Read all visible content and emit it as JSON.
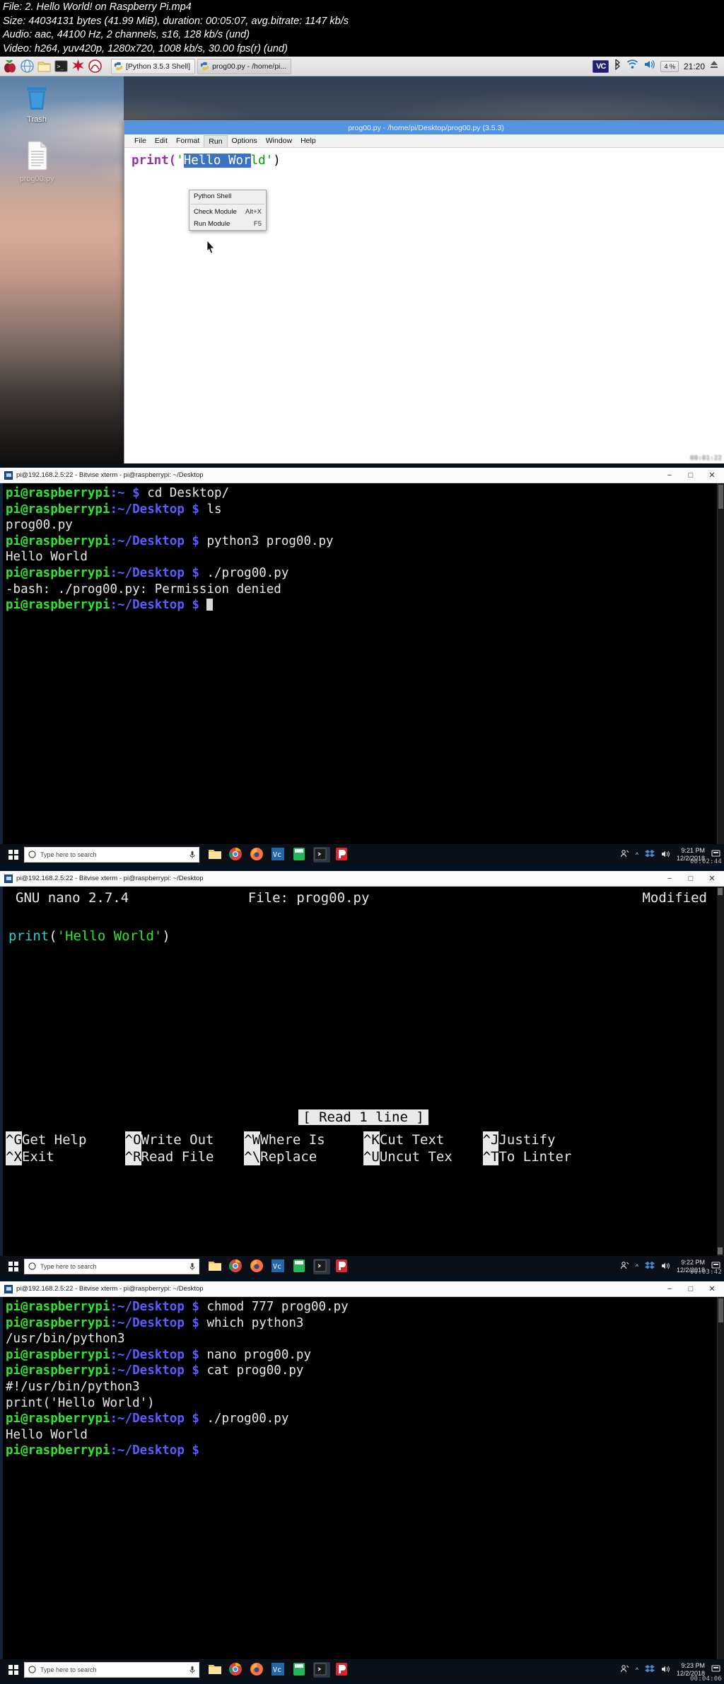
{
  "fileinfo": {
    "line1": "File: 2. Hello World! on Raspberry Pi.mp4",
    "line2": "Size: 44034131 bytes (41.99 MiB), duration: 00:05:07, avg.bitrate: 1147 kb/s",
    "line3": "Audio: aac, 44100 Hz, 2 channels, s16, 128 kb/s (und)",
    "line4": "Video: h264, yuv420p, 1280x720, 1008 kb/s, 30.00 fps(r) (und)"
  },
  "panel1": {
    "taskbar": {
      "icons": [
        "raspberry-menu-icon",
        "globe-browser-icon",
        "file-manager-icon",
        "terminal-icon",
        "wolfram-icon",
        "mathematica-icon"
      ],
      "tasks": [
        {
          "label": "[Python 3.5.3 Shell]",
          "active": false
        },
        {
          "label": "prog00.py - /home/pi...",
          "active": true
        }
      ],
      "vnc_label": "VC",
      "cpu_label": "4 %",
      "clock": "21:20",
      "tray_icons": [
        "bluetooth-icon",
        "wifi-icon",
        "volume-icon",
        "cpu-meter-icon",
        "eject-icon"
      ]
    },
    "desktop_icons": [
      {
        "label": "Trash",
        "icon": "trash-icon"
      },
      {
        "label": "prog00.py",
        "icon": "document-icon"
      }
    ],
    "idle": {
      "title": "prog00.py - /home/pi/Desktop/prog00.py (3.5.3)",
      "menus": [
        "File",
        "Edit",
        "Format",
        "Run",
        "Options",
        "Window",
        "Help"
      ],
      "open_menu": "Run",
      "code_prefix": "print(",
      "code_quote1": "'",
      "code_selected": "Hello Wor",
      "code_tail": "ld'",
      "code_suffix": ")",
      "run_menu": [
        {
          "label": "Python Shell",
          "accel": ""
        },
        {
          "label": "Check Module",
          "accel": "Alt+X"
        },
        {
          "label": "Run Module",
          "accel": "F5"
        }
      ]
    },
    "timestamp": "00:01:22"
  },
  "panel2": {
    "window_title": "pi@192.168.2.5:22 - Bitvise xterm - pi@raspberrypi: ~/Desktop",
    "win_buttons": [
      "minimize",
      "maximize",
      "close"
    ],
    "lines": [
      {
        "user": "pi@raspberrypi",
        "path": ":~",
        "dollar": " $ ",
        "cmd": "cd Desktop/"
      },
      {
        "user": "pi@raspberrypi",
        "path": ":~/Desktop",
        "dollar": " $ ",
        "cmd": "ls"
      },
      {
        "out": "prog00.py"
      },
      {
        "user": "pi@raspberrypi",
        "path": ":~/Desktop",
        "dollar": " $ ",
        "cmd": "python3 prog00.py"
      },
      {
        "out": "Hello World"
      },
      {
        "user": "pi@raspberrypi",
        "path": ":~/Desktop",
        "dollar": " $ ",
        "cmd": "./prog00.py"
      },
      {
        "out": "-bash: ./prog00.py: Permission denied"
      },
      {
        "user": "pi@raspberrypi",
        "path": ":~/Desktop",
        "dollar": " $ ",
        "cmd": "",
        "cursor": true
      }
    ],
    "taskbar": {
      "search_placeholder": "Type here to search",
      "clock_time": "9:21 PM",
      "clock_date": "12/2/2018"
    },
    "timestamp": "00:02:44"
  },
  "panel3": {
    "window_title": "pi@192.168.2.5:22 - Bitvise xterm - pi@raspberrypi: ~/Desktop",
    "nano": {
      "version": "GNU nano 2.7.4",
      "file": "File: prog00.py",
      "status": "Modified",
      "code_func": "print",
      "code_open": "(",
      "code_str": "'Hello World'",
      "code_close": ")",
      "message": "[ Read 1 line ]",
      "keys_row1": [
        {
          "key": "^G",
          "label": " Get Help "
        },
        {
          "key": "^O",
          "label": " Write Out"
        },
        {
          "key": "^W",
          "label": " Where Is "
        },
        {
          "key": "^K",
          "label": " Cut Text "
        },
        {
          "key": "^J",
          "label": " Justify"
        }
      ],
      "keys_row2": [
        {
          "key": "^X",
          "label": " Exit     "
        },
        {
          "key": "^R",
          "label": " Read File"
        },
        {
          "key": "^\\",
          "label": " Replace  "
        },
        {
          "key": "^U",
          "label": " Uncut Tex"
        },
        {
          "key": "^T",
          "label": " To Linter"
        }
      ]
    },
    "taskbar": {
      "search_placeholder": "Type here to search",
      "clock_time": "9:22 PM",
      "clock_date": "12/2/2018"
    },
    "timestamp": "00:03:42"
  },
  "panel4": {
    "window_title": "pi@192.168.2.5:22 - Bitvise xterm - pi@raspberrypi: ~/Desktop",
    "lines": [
      {
        "user": "pi@raspberrypi",
        "path": ":~/Desktop",
        "dollar": " $ ",
        "cmd": "chmod 777 prog00.py"
      },
      {
        "user": "pi@raspberrypi",
        "path": ":~/Desktop",
        "dollar": " $ ",
        "cmd": "which python3"
      },
      {
        "out": "/usr/bin/python3"
      },
      {
        "user": "pi@raspberrypi",
        "path": ":~/Desktop",
        "dollar": " $ ",
        "cmd": "nano prog00.py"
      },
      {
        "user": "pi@raspberrypi",
        "path": ":~/Desktop",
        "dollar": " $ ",
        "cmd": "cat prog00.py"
      },
      {
        "out": "#!/usr/bin/python3"
      },
      {
        "out": "print('Hello World')"
      },
      {
        "user": "pi@raspberrypi",
        "path": ":~/Desktop",
        "dollar": " $ ",
        "cmd": "./prog00.py"
      },
      {
        "out": "Hello World"
      },
      {
        "user": "pi@raspberrypi",
        "path": ":~/Desktop",
        "dollar": " $ ",
        "cmd": ""
      }
    ],
    "taskbar": {
      "search_placeholder": "Type here to search",
      "clock_time": "9:23 PM",
      "clock_date": "12/2/2018"
    },
    "timestamp": "00:04:06"
  },
  "colors": {
    "terminal_green": "#2ee62e",
    "terminal_blue": "#5c5cff",
    "idle_title_blue": "#5294e2",
    "nano_cyan": "#28d2d2"
  }
}
